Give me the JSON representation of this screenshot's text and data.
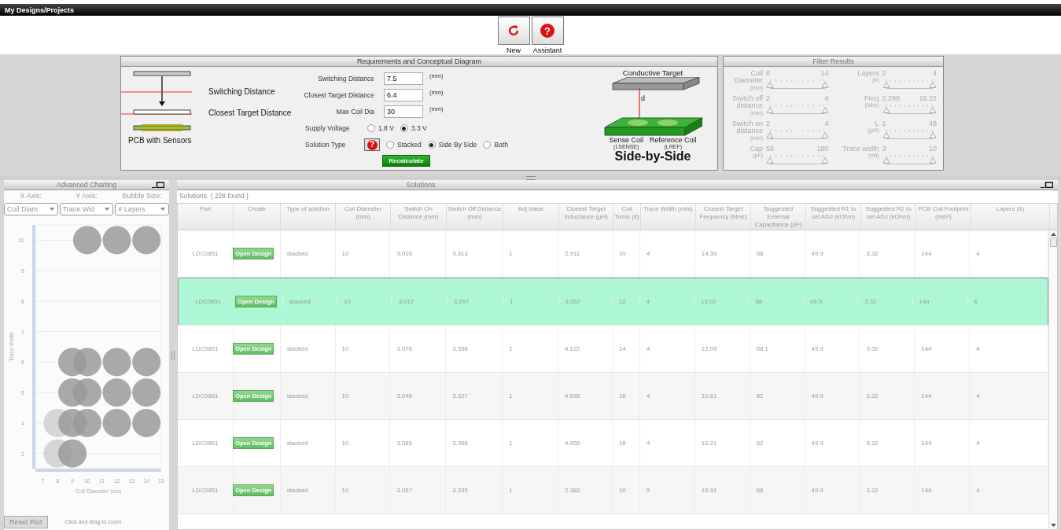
{
  "window": {
    "title": "My Designs/Projects"
  },
  "toolbar": [
    {
      "kind": "new",
      "label": "New"
    },
    {
      "kind": "assistant",
      "label": "Assistant",
      "icon": "?"
    }
  ],
  "requirements": {
    "title": "Requirements and Conceptual Diagram",
    "diagram_labels": [
      "Switching Distance",
      "Closest Target Distance",
      "PCB with Sensors"
    ],
    "fields": [
      {
        "label": "Switching Distance",
        "value": "7.5",
        "unit": "(mm)"
      },
      {
        "label": "Closest Target Distance",
        "value": "6.4",
        "unit": "(mm)"
      },
      {
        "label": "Max Coil Dia",
        "value": "30",
        "unit": "(mm)"
      }
    ],
    "supply_voltage": {
      "label": "Supply Voltage",
      "options": [
        {
          "label": "1.8 V",
          "selected": false
        },
        {
          "label": "3.3 V",
          "selected": true
        }
      ]
    },
    "solution_type": {
      "label": "Solution Type",
      "help_icon": "?",
      "options": [
        {
          "label": "Stacked",
          "selected": false
        },
        {
          "label": "Side By Side",
          "selected": true
        },
        {
          "label": "Both",
          "selected": false
        }
      ]
    },
    "recalculate": "Recalculate",
    "target_diagram": {
      "target": "Conductive Target",
      "distance": "d",
      "sense": "Sense Coil",
      "sense_sub": "(LSENSE)",
      "reference": "Reference Coil",
      "reference_sub": "(LREF)",
      "caption": "Side-by-Side"
    }
  },
  "filter": {
    "title": "Filter Results",
    "columns": [
      [
        {
          "label": "Coil",
          "label2": "Diameter",
          "unit": "(mm)",
          "min": "8",
          "max": "14",
          "level": 1
        },
        {
          "label": "Switch off",
          "label2": "distance",
          "unit": "(mm)",
          "min": "2",
          "max": "4",
          "level": 1
        },
        {
          "label": "Switch on",
          "label2": "distance",
          "unit": "(mm)",
          "min": "2",
          "max": "4",
          "level": 1
        },
        {
          "label": "Cap",
          "unit": "(pF)",
          "min": "56",
          "max": "180",
          "level": 1
        }
      ],
      [
        {
          "label": "Layers",
          "unit": "(#)",
          "min": "2",
          "max": "4",
          "level": 1
        },
        {
          "label": "Freq",
          "unit": "(Mhz)",
          "min": "2.299",
          "max": "18.22",
          "level": 1
        },
        {
          "label": "L",
          "unit": "(µH)",
          "min": "1",
          "max": "49",
          "level": 1
        },
        {
          "label": "Trace width",
          "unit": "(mil)",
          "min": "3",
          "max": "10",
          "level": 1
        }
      ]
    ]
  },
  "charting": {
    "title": "Advanced Charting",
    "axes": [
      {
        "label": "X Axis:",
        "value": "Coil Diam"
      },
      {
        "label": "Y Axis:",
        "value": "Trace Wid"
      },
      {
        "label": "Bubble Size:",
        "value": "# Layers"
      }
    ],
    "chart_data": {
      "type": "scatter",
      "xlabel": "Coil Diameter (cm)",
      "ylabel": "Trace Width",
      "grid": true,
      "xlim": [
        6.5,
        15
      ],
      "ylim": [
        2.5,
        10.5
      ],
      "xticks": [
        7,
        8,
        9,
        10,
        11,
        12,
        13,
        14,
        15
      ],
      "yticks": [
        3,
        4,
        5,
        6,
        7,
        8,
        9,
        10
      ],
      "series": [
        {
          "color": "#cfcfcf",
          "x": [
            8,
            8
          ],
          "values": [
            4,
            3
          ]
        },
        {
          "color": "#9a9a9a",
          "x": [
            10,
            12,
            14,
            9,
            10,
            12,
            14,
            9,
            10,
            12,
            14,
            9,
            10,
            12,
            14,
            9
          ],
          "values": [
            10,
            10,
            10,
            6,
            6,
            6,
            6,
            5,
            5,
            5,
            5,
            4,
            4,
            4,
            4,
            3
          ]
        }
      ]
    },
    "reset": "Reset Plot",
    "hint": "Click and drag to zoom"
  },
  "solutions": {
    "title": "Solutions",
    "count_label": "Solutions:  ( 228  found )",
    "columns": [
      "Part",
      "Create",
      "Type of solution",
      "Coil Diameter (mm)",
      "Switch On Distance (mm)",
      "Switch Off Distance (mm)",
      "Adj Value",
      "Closest Target Inductance (µH)",
      "Coil Turns (#)",
      "Trace Width (mils)",
      "Closest Target Frequency (MHz)",
      "Suggested External Capacitance (pF)",
      "Suggested R1 to set ADJ (kOhm)",
      "Suggested R2 to set ADJ (kOhm)",
      "PCB Coil Footprint (mm²)",
      "Layers (#)"
    ],
    "rows": [
      {
        "selected": false,
        "cells": [
          "LDC0851",
          "Open Design",
          "stacked",
          "10",
          "3.016",
          "3.313",
          "1",
          "2.911",
          "10",
          "4",
          "14.39",
          "68",
          "49.9",
          "3.32",
          "144",
          "4"
        ]
      },
      {
        "selected": true,
        "cells": [
          "LDC0851",
          "Open Design",
          "stacked",
          "10",
          "3.012",
          "3.297",
          "1",
          "3.557",
          "12",
          "4",
          "13.02",
          "68",
          "49.9",
          "3.32",
          "144",
          "4"
        ]
      },
      {
        "selected": false,
        "cells": [
          "LDC0851",
          "Open Design",
          "stacked",
          "10",
          "3.076",
          "3.356",
          "1",
          "4.122",
          "14",
          "4",
          "12.09",
          "68.1",
          "49.9",
          "3.32",
          "144",
          "4"
        ]
      },
      {
        "selected": false,
        "cells": [
          "LDC0851",
          "Open Design",
          "stacked",
          "10",
          "3.046",
          "3.327",
          "1",
          "4.595",
          "16",
          "4",
          "10.61",
          "82",
          "49.9",
          "3.32",
          "144",
          "4"
        ]
      },
      {
        "selected": false,
        "cells": [
          "LDC0851",
          "Open Design",
          "stacked",
          "10",
          "3.085",
          "3.366",
          "1",
          "4.955",
          "18",
          "4",
          "10.21",
          "82",
          "49.9",
          "3.32",
          "144",
          "4"
        ]
      },
      {
        "selected": false,
        "cells": [
          "LDC0851",
          "Open Design",
          "stacked",
          "10",
          "3.057",
          "3.335",
          "1",
          "2.382",
          "10",
          "5",
          "15.91",
          "68",
          "49.9",
          "3.32",
          "144",
          "4"
        ]
      }
    ]
  }
}
